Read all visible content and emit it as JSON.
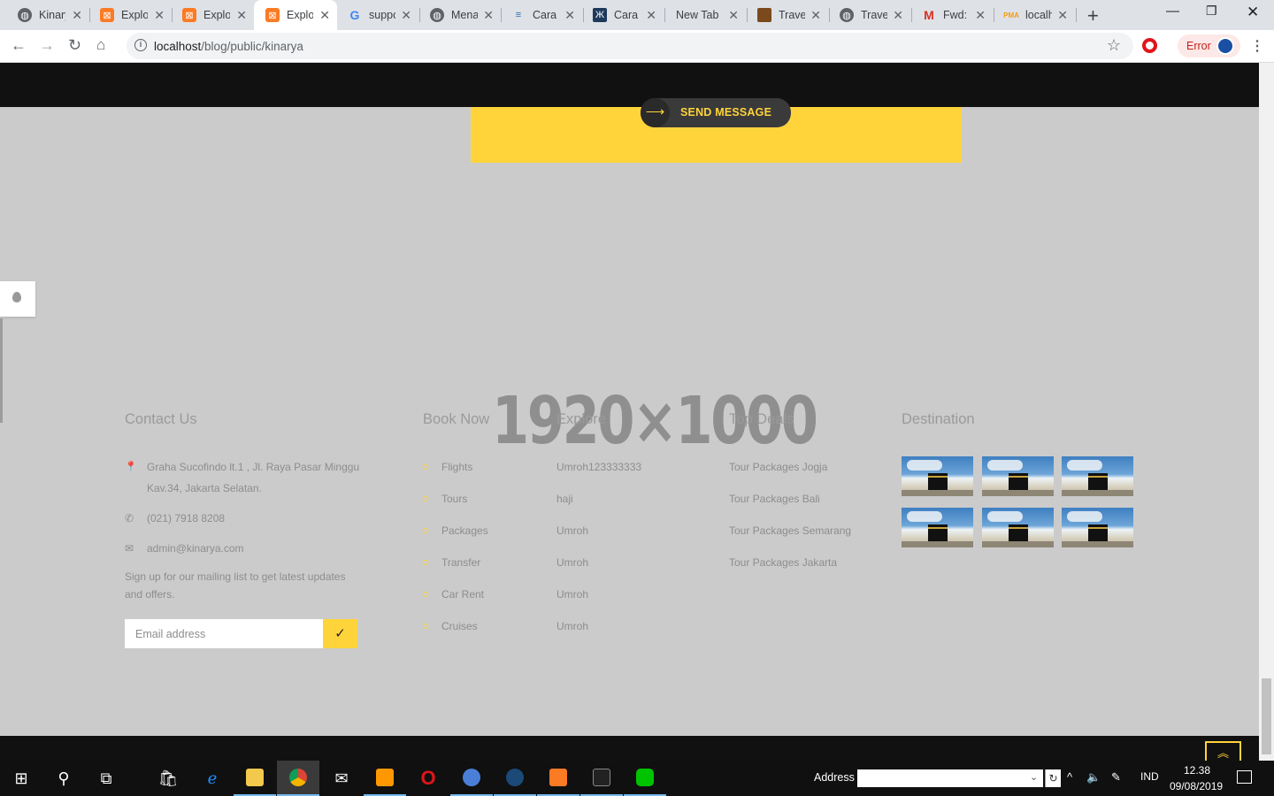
{
  "browser": {
    "tabs": [
      {
        "label": "Kinarya",
        "icon": "globe-icon"
      },
      {
        "label": "Explore",
        "icon": "xampp-icon"
      },
      {
        "label": "Explore",
        "icon": "xampp-icon"
      },
      {
        "label": "Explore",
        "icon": "xampp-icon",
        "active": true
      },
      {
        "label": "support",
        "icon": "google-icon"
      },
      {
        "label": "Menam",
        "icon": "globe-icon"
      },
      {
        "label": "Cara",
        "icon": "db-icon"
      },
      {
        "label": "Cara",
        "icon": "book-icon"
      },
      {
        "label": "New Tab",
        "icon": ""
      },
      {
        "label": "Travel",
        "icon": "photo-icon"
      },
      {
        "label": "Travel",
        "icon": "globe-icon"
      },
      {
        "label": "Fwd:",
        "icon": "gmail-icon"
      },
      {
        "label": "localhost",
        "icon": "pma-icon"
      }
    ],
    "url_host": "localhost",
    "url_path": "/blog/public/kinarya",
    "profile_status": "Error"
  },
  "page": {
    "send_button": "SEND MESSAGE",
    "placeholder_watermark": "1920×1000",
    "contact": {
      "title": "Contact Us",
      "address_line1": "Graha Sucofindo lt.1 , Jl. Raya Pasar Minggu",
      "address_line2": "Kav.34, Jakarta Selatan.",
      "phone": "(021) 7918 8208",
      "email": "admin@kinarya.com",
      "newsletter_line1": "Sign up for our mailing list to get latest updates",
      "newsletter_line2": "and offers.",
      "email_placeholder": "Email address",
      "submit": "✓"
    },
    "book_now": {
      "title": "Book Now",
      "items": [
        "Flights",
        "Tours",
        "Packages",
        "Transfer",
        "Car Rent",
        "Cruises"
      ]
    },
    "explore": {
      "title": "Explore",
      "items": [
        "Umroh123333333",
        "haji",
        "Umroh",
        "Umroh",
        "Umroh",
        "Umroh"
      ]
    },
    "top_deals": {
      "title": "Top Deals",
      "items": [
        "Tour Packages Jogja",
        "Tour Packages Bali",
        "Tour Packages Semarang",
        "Tour Packages Jakarta"
      ]
    },
    "destination": {
      "title": "Destination",
      "thumb_count": 6
    }
  },
  "taskbar": {
    "address_label": "Address",
    "language": "IND",
    "time": "12.38",
    "date": "09/08/2019"
  }
}
